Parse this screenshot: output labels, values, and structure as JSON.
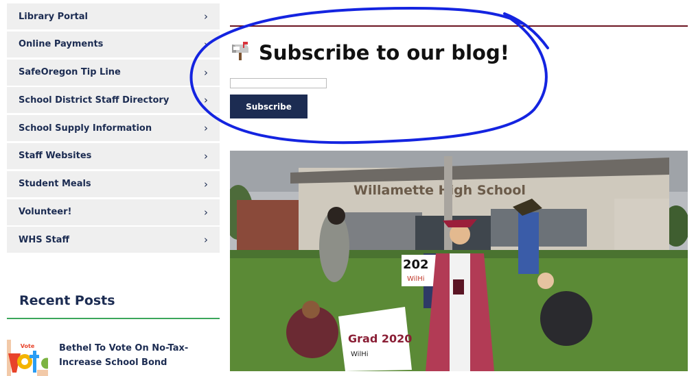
{
  "sidebar": {
    "items": [
      {
        "label": "Library Portal"
      },
      {
        "label": "Online Payments"
      },
      {
        "label": "SafeOregon Tip Line"
      },
      {
        "label": "School District Staff Directory"
      },
      {
        "label": "School Supply Information"
      },
      {
        "label": "Staff Websites"
      },
      {
        "label": "Student Meals"
      },
      {
        "label": "Volunteer!"
      },
      {
        "label": "WHS Staff"
      }
    ],
    "chevron": "›"
  },
  "recent_posts": {
    "title": "Recent Posts",
    "posts": [
      {
        "title": "Bethel To Vote On No-Tax-Increase School Bond",
        "thumb_text": "Vote"
      }
    ]
  },
  "blog_subscribe": {
    "heading": "Subscribe to our blog!",
    "icon": "mailbox-icon",
    "email_value": "",
    "button_label": "Subscribe"
  },
  "photo": {
    "building_sign": "Willamette High School",
    "sign_left": "202",
    "sign_left_sub": "WilHi",
    "sign_front": "Grad 2020",
    "sign_front_sub": "WilHi"
  },
  "colors": {
    "navy": "#1c2c52",
    "maroon_rule": "#6b1420",
    "green_rule": "#3aa65a",
    "annotation_blue": "#1424e0"
  }
}
